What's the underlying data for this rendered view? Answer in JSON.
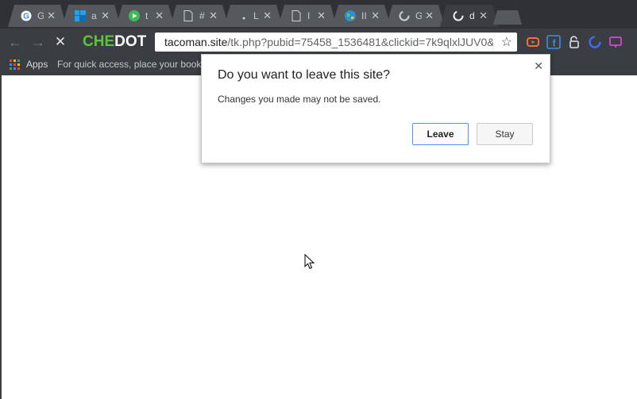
{
  "tabs": [
    {
      "title": "G",
      "icon": "google-icon",
      "active": false
    },
    {
      "title": "a",
      "icon": "blue-squares-icon",
      "active": false
    },
    {
      "title": "t",
      "icon": "play-icon",
      "active": false
    },
    {
      "title": "#",
      "icon": "document-icon",
      "active": false
    },
    {
      "title": "L",
      "icon": "dot-icon",
      "active": false
    },
    {
      "title": "I",
      "icon": "document-icon",
      "active": false
    },
    {
      "title": "II",
      "icon": "globe-icon",
      "active": false
    },
    {
      "title": "G",
      "icon": "spinner-icon",
      "active": false
    },
    {
      "title": "d",
      "icon": "spinner-icon",
      "active": true
    }
  ],
  "toolbar": {
    "brand_first": "CHE",
    "brand_second": "DOT",
    "url_host": "tacoman.site",
    "url_path": "/tk.php?pubid=75458_1536481&clickid=7k9qlxlJUV0&"
  },
  "bookmarks": {
    "apps_label": "Apps",
    "hint": "For quick access, place your bookm"
  },
  "dialog": {
    "title": "Do you want to leave this site?",
    "message": "Changes you made may not be saved.",
    "leave_label": "Leave",
    "stay_label": "Stay"
  },
  "colors": {
    "brand_green": "#5cc43a",
    "toolbar_bg": "#3a3d42",
    "tabstrip_bg": "#2f3136",
    "focus_blue": "#4d90fe"
  }
}
